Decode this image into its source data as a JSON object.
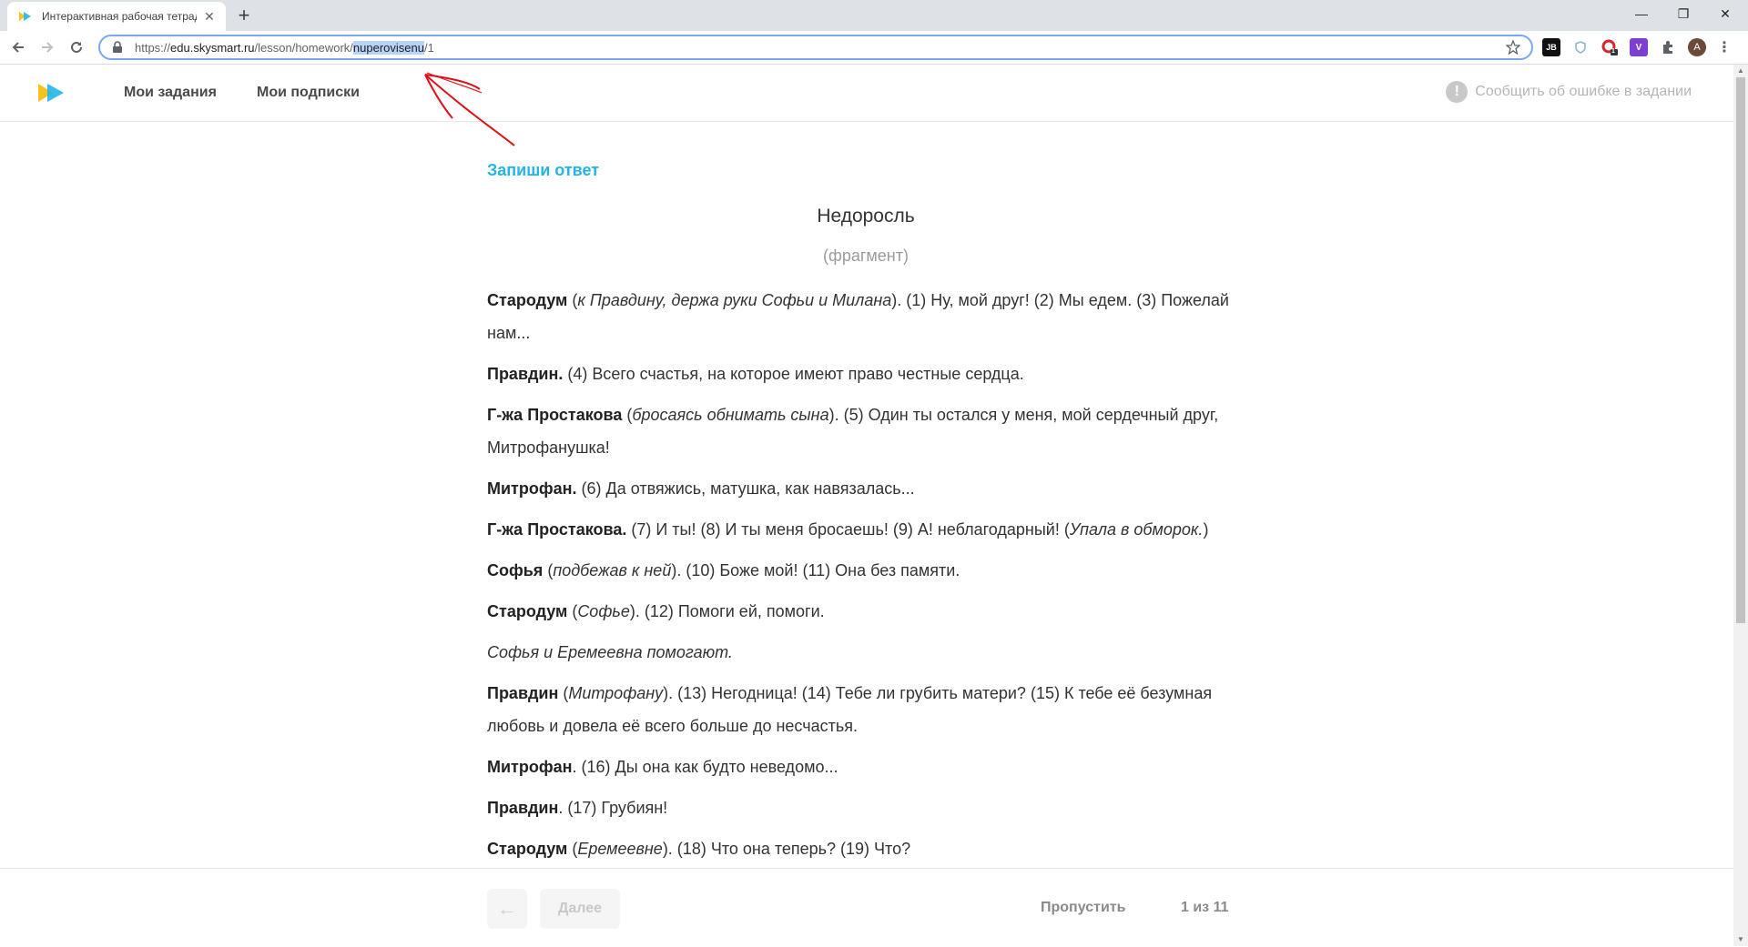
{
  "browser": {
    "tab_title": "Интерактивная рабочая тетрадь",
    "url_scheme": "https://",
    "url_host": "edu.skysmart.ru",
    "url_path": "/lesson/homework/",
    "url_selected": "nuperovisenu",
    "url_tail": "/1",
    "ext_jb": "JB",
    "ext_badge": "1",
    "ext_v": "V",
    "avatar": "A",
    "accent": "#7aa7f0"
  },
  "header": {
    "nav": [
      "Мои задания",
      "Мои подписки"
    ],
    "report": "Сообщить об ошибке в задании",
    "report_icon": "!"
  },
  "task": {
    "instruction": "Запиши ответ",
    "title": "Недоросль",
    "subtitle": "(фрагмент)",
    "paragraphs": [
      {
        "speaker": "Стародум",
        "pre": " (",
        "remark": "к Правдину, держа руки Софьи и Милана",
        "text": "). (1) Ну, мой друг! (2) Мы едем. (3) Пожелай нам..."
      },
      {
        "speaker": "Правдин.",
        "pre": "",
        "remark": "",
        "text": " (4) Всего счастья, на которое имеют право честные сердца."
      },
      {
        "speaker": "Г-жа Простакова",
        "pre": " (",
        "remark": "бросаясь обнимать сына",
        "text": "). (5) Один ты остался у меня, мой сердечный друг, Митрофанушка!"
      },
      {
        "speaker": "Митрофан.",
        "pre": "",
        "remark": "",
        "text": " (6) Да отвяжись, матушка, как навязалась..."
      },
      {
        "speaker": "Г-жа Простакова.",
        "pre": "",
        "remark": "",
        "text": " (7) И ты! (8) И ты меня бросаешь! (9) А! неблагодарный! (",
        "remark2": "Упала в обморок.",
        "tail": ")"
      },
      {
        "speaker": "Софья",
        "pre": " (",
        "remark": "подбежав к ней",
        "text": "). (10) Боже мой! (11) Она без памяти."
      },
      {
        "speaker": "Стародум",
        "pre": " (",
        "remark": "Софье",
        "text": "). (12) Помоги ей, помоги."
      },
      {
        "speaker": "",
        "pre": "",
        "remark": "Софья и Еремеевна помогают.",
        "text": ""
      },
      {
        "speaker": "Правдин",
        "pre": " (",
        "remark": "Митрофану",
        "text": "). (13) Негодница! (14) Тебе ли грубить матери? (15) К тебе её безумная любовь и довела её всего больше до несчастья."
      },
      {
        "speaker": "Митрофан",
        "pre": "",
        "remark": "",
        "text": ". (16) Ды она как будто неведомо..."
      },
      {
        "speaker": "Правдин",
        "pre": "",
        "remark": "",
        "text": ". (17) Грубиян!"
      },
      {
        "speaker": "Стародум",
        "pre": " (",
        "remark": "Еремеевне",
        "text": "). (18) Что она теперь? (19) Что?"
      }
    ]
  },
  "footer": {
    "back": "←",
    "next": "Далее",
    "skip": "Пропустить",
    "counter": "1 из 11"
  },
  "colors": {
    "instruction": "#22b5e6",
    "annotation": "#e0101a"
  }
}
